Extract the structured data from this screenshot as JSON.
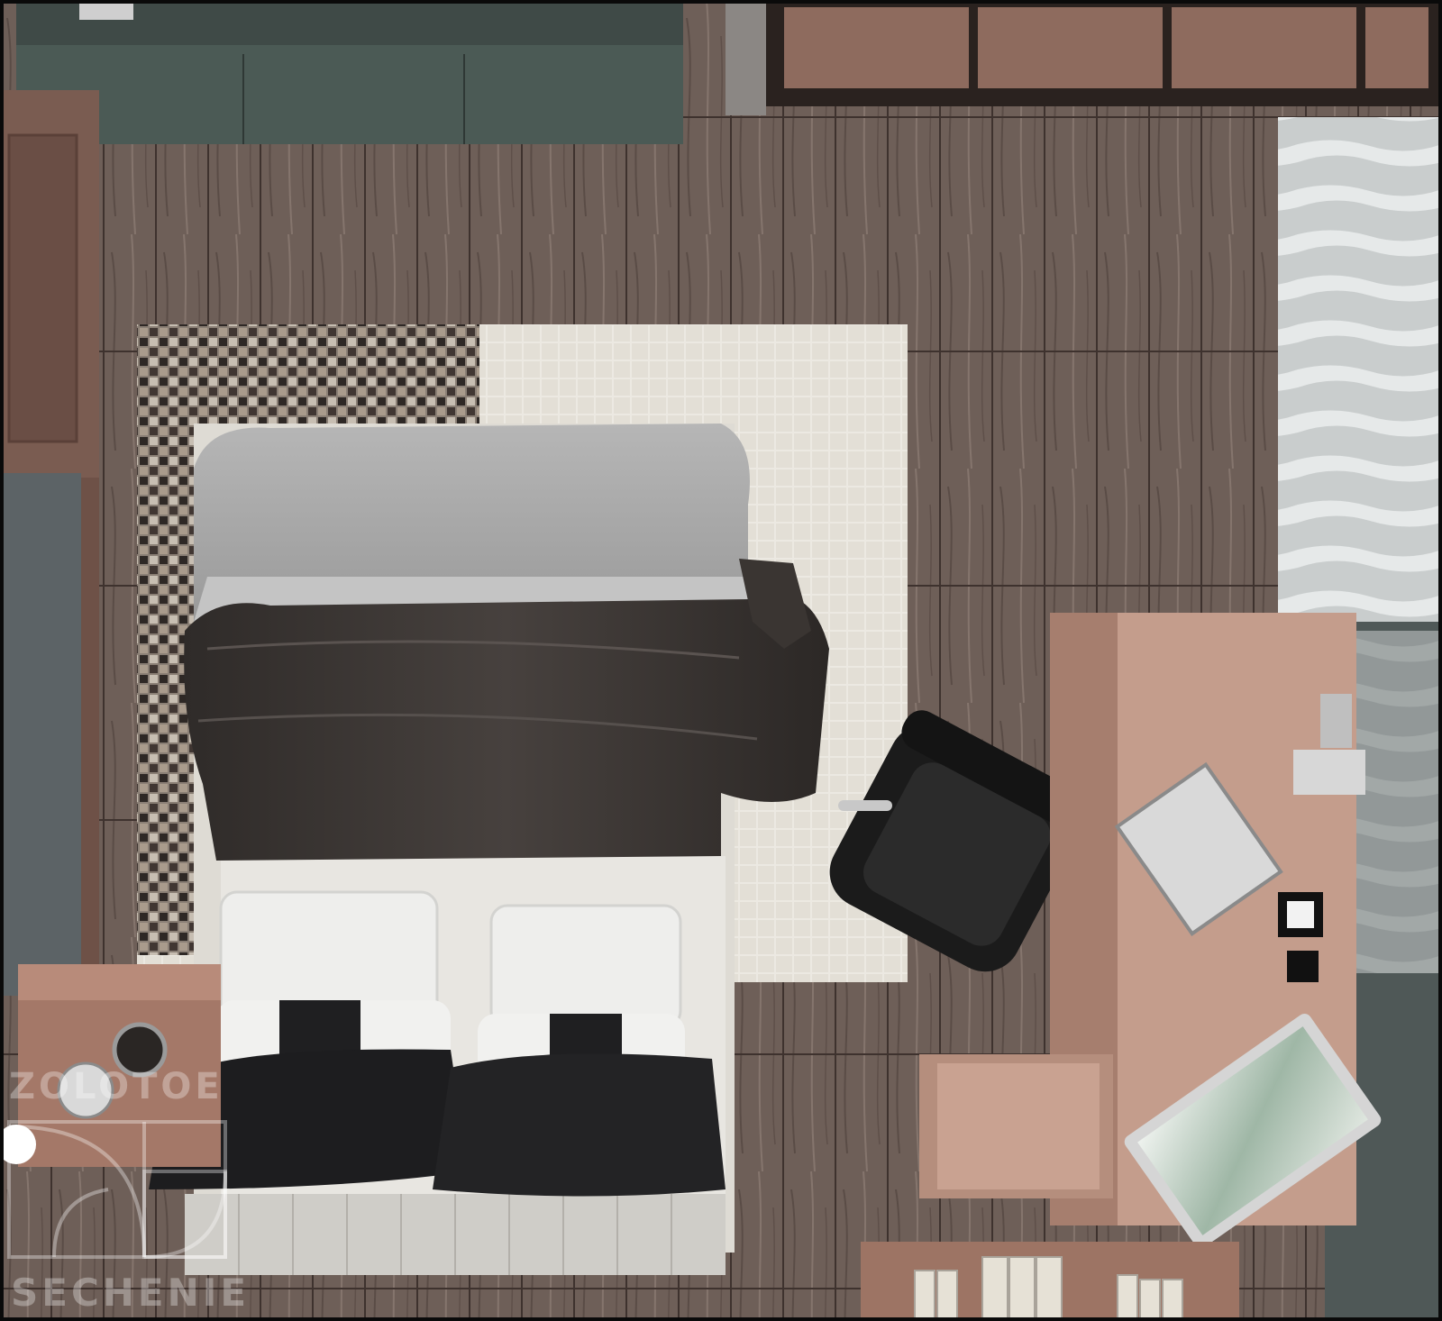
{
  "image": {
    "kind": "top-down interior render",
    "subject": "bedroom",
    "colors": {
      "floor": "#6e5f58",
      "floor_dark": "#4d403b",
      "wall_panel": "#8a6a5e",
      "rug_light": "#e8e4dc",
      "rug_dark": "#3a332f",
      "sheet_grey": "#a9a9a9",
      "blanket": "#3d3835",
      "pillow_white": "#e9e9e7",
      "pillow_black": "#1d1d1f",
      "desk": "#c49d8c",
      "chair": "#1b1b1b",
      "wardrobe": "#3f4a47",
      "curtain": "#cfd3d3"
    }
  },
  "watermark": {
    "line1": "ZOLOTOE",
    "line2": "SECHENIE",
    "color": "#ffffff"
  }
}
